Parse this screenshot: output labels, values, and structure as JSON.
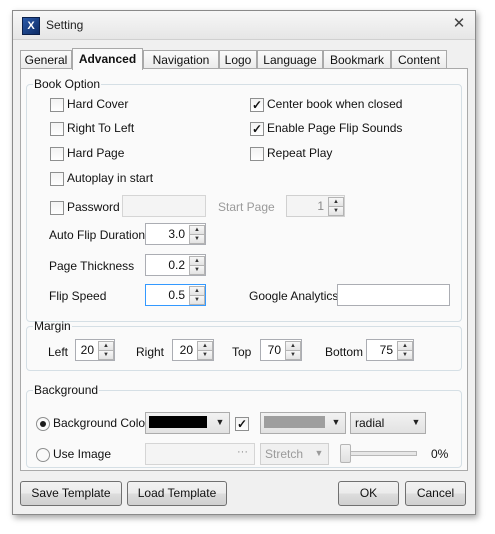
{
  "window": {
    "title": "Setting",
    "icon": "X"
  },
  "tabs": [
    {
      "label": "General"
    },
    {
      "label": "Advanced"
    },
    {
      "label": "Navigation"
    },
    {
      "label": "Logo"
    },
    {
      "label": "Language"
    },
    {
      "label": "Bookmark"
    },
    {
      "label": "Content"
    }
  ],
  "active_tab": "Advanced",
  "book_option": {
    "legend": "Book Option",
    "hard_cover": {
      "label": "Hard Cover",
      "checked": false
    },
    "right_to_left": {
      "label": "Right To Left",
      "checked": false
    },
    "hard_page": {
      "label": "Hard Page",
      "checked": false
    },
    "autoplay": {
      "label": "Autoplay in start",
      "checked": false
    },
    "password": {
      "label": "Password",
      "checked": false,
      "value": ""
    },
    "center_book": {
      "label": "Center book when closed",
      "checked": true
    },
    "flip_sounds": {
      "label": "Enable Page Flip Sounds",
      "checked": true
    },
    "repeat_play": {
      "label": "Repeat Play",
      "checked": false
    },
    "start_page": {
      "label": "Start Page",
      "value": "1"
    },
    "auto_flip_duration": {
      "label": "Auto Flip Duration",
      "value": "3.0"
    },
    "page_thickness": {
      "label": "Page Thickness",
      "value": "0.2"
    },
    "flip_speed": {
      "label": "Flip Speed",
      "value": "0.5"
    },
    "google_analytics": {
      "label": "Google Analytics",
      "value": ""
    }
  },
  "margin": {
    "legend": "Margin",
    "left": {
      "label": "Left",
      "value": "20"
    },
    "right": {
      "label": "Right",
      "value": "20"
    },
    "top": {
      "label": "Top",
      "value": "70"
    },
    "bottom": {
      "label": "Bottom",
      "value": "75"
    }
  },
  "background": {
    "legend": "Background",
    "bg_color": {
      "label": "Background Color",
      "selected": true,
      "color": "#000000",
      "checked": true,
      "second_color": "#9e9e9e",
      "gradient": "radial"
    },
    "use_image": {
      "label": "Use Image",
      "selected": false,
      "browse": "···",
      "fit": "Stretch",
      "opacity_percent": "0%",
      "opacity_level": 0
    }
  },
  "footer": {
    "save_template": "Save  Template",
    "load_template": "Load  Template",
    "ok": "OK",
    "cancel": "Cancel"
  },
  "icons": {
    "close": "close-icon",
    "check": "checkmark-icon",
    "spin_up": "arrow-up-icon",
    "spin_down": "arrow-down-icon",
    "dropdown": "chevron-down-icon"
  }
}
